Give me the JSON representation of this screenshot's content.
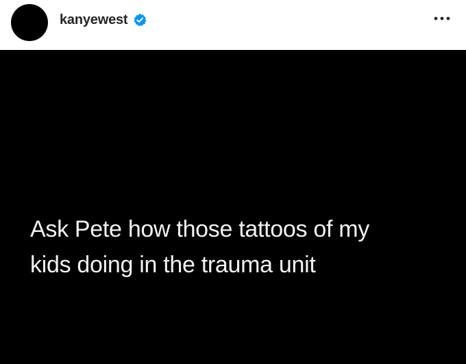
{
  "header": {
    "username": "kanyewest",
    "verified": true,
    "verified_icon": "verified-badge-icon",
    "more_icon": "more-options-icon",
    "badge_color": "#0095f6"
  },
  "post": {
    "background_color": "#000000",
    "text_color": "#f2f2f2",
    "caption_lines": [
      "Ask Pete how those tattoos of my",
      "kids doing in the trauma unit"
    ]
  }
}
